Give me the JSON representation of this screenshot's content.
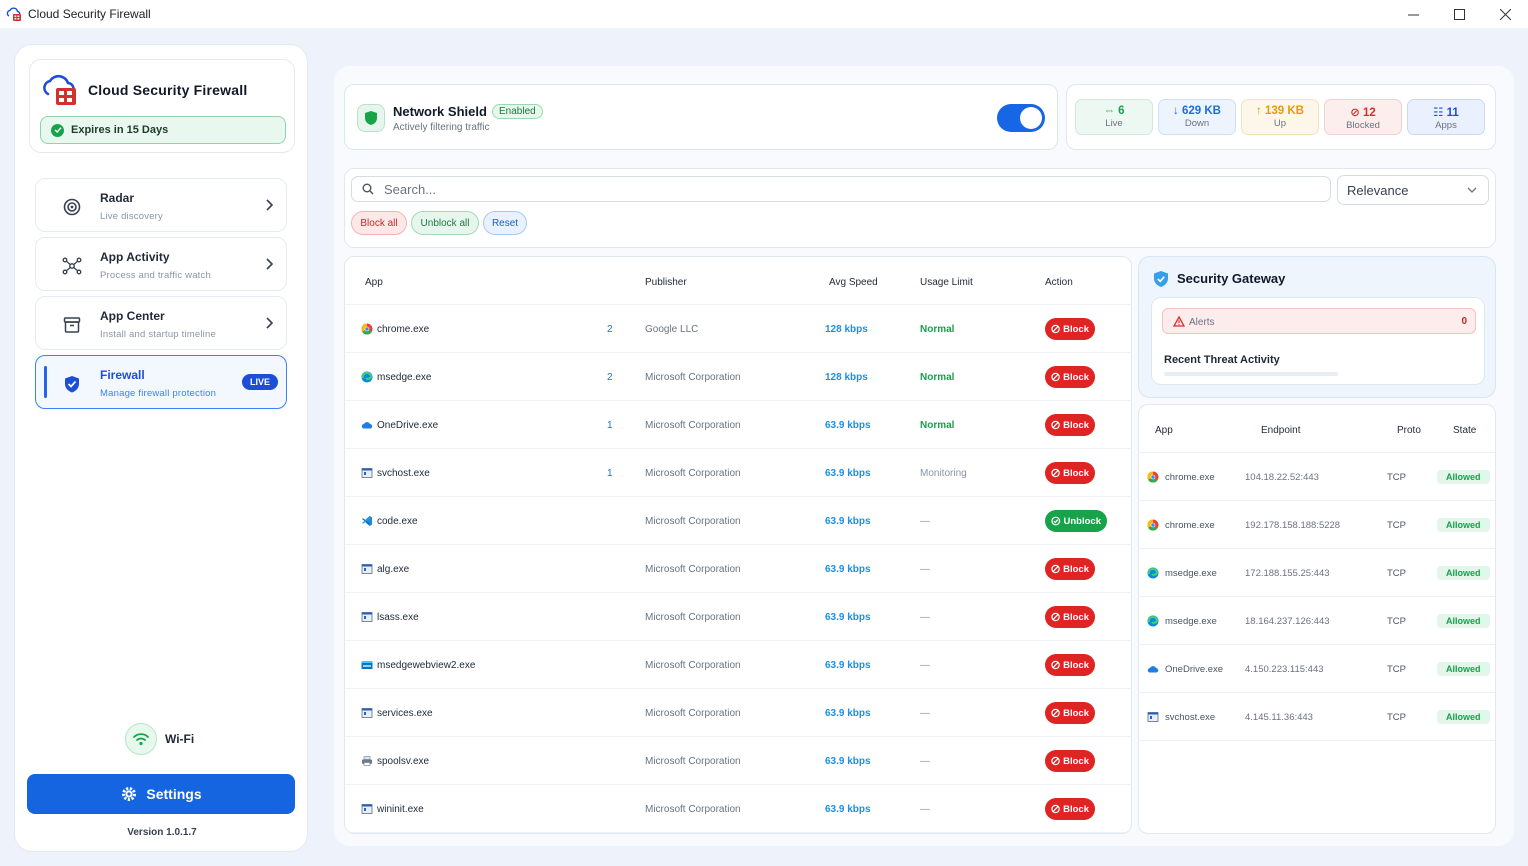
{
  "window": {
    "title": "Cloud Security Firewall",
    "minimize": "—",
    "maximize": "☐",
    "close": "✕"
  },
  "sidebar": {
    "brand": "Cloud Security Firewall",
    "expires": "Expires in 15 Days",
    "items": [
      {
        "label": "Radar",
        "sub": "Live discovery"
      },
      {
        "label": "App Activity",
        "sub": "Process and traffic watch"
      },
      {
        "label": "App Center",
        "sub": "Install and startup timeline"
      },
      {
        "label": "Firewall",
        "sub": "Manage firewall protection",
        "badge": "LIVE"
      }
    ],
    "wifi": "Wi-Fi",
    "settings": "Settings",
    "version": "Version 1.0.1.7"
  },
  "shield": {
    "title": "Network Shield",
    "badge": "Enabled",
    "sub": "Actively filtering traffic",
    "enabled": true
  },
  "stats": [
    {
      "value": "⇔ 6",
      "label": "Live",
      "color": "#16a34a",
      "bg": "#eef8f2",
      "border": "#cfe9da"
    },
    {
      "value": "↓ 629 KB",
      "label": "Down",
      "color": "#1d6fd8",
      "bg": "#edf4fd",
      "border": "#cfe0f5"
    },
    {
      "value": "↑ 139 KB",
      "label": "Up",
      "color": "#e59a0e",
      "bg": "#fdf7ea",
      "border": "#f3e2b8"
    },
    {
      "value": "⊘ 12",
      "label": "Blocked",
      "color": "#d32f2f",
      "bg": "#fdeeee",
      "border": "#f4cfcf"
    },
    {
      "value": "☷ 11",
      "label": "Apps",
      "color": "#1d4ed8",
      "bg": "#eaf0fd",
      "border": "#cbd8f5"
    }
  ],
  "search": {
    "placeholder": "Search...",
    "sort": "Relevance",
    "block_all": "Block all",
    "unblock_all": "Unblock all",
    "reset": "Reset"
  },
  "apps": {
    "headers": {
      "app": "App",
      "publisher": "Publisher",
      "speed": "Avg Speed",
      "usage": "Usage Limit",
      "action": "Action"
    },
    "rows": [
      {
        "name": "chrome.exe",
        "count": "2",
        "publisher": "Google LLC",
        "speed": "128 kbps",
        "usage": "Normal",
        "usage_type": "normal",
        "action": "Block",
        "icon": "chrome-icon"
      },
      {
        "name": "msedge.exe",
        "count": "2",
        "publisher": "Microsoft Corporation",
        "speed": "128 kbps",
        "usage": "Normal",
        "usage_type": "normal",
        "action": "Block",
        "icon": "edge-icon"
      },
      {
        "name": "OneDrive.exe",
        "count": "1",
        "publisher": "Microsoft Corporation",
        "speed": "63.9 kbps",
        "usage": "Normal",
        "usage_type": "normal",
        "action": "Block",
        "icon": "onedrive-icon"
      },
      {
        "name": "svchost.exe",
        "count": "1",
        "publisher": "Microsoft Corporation",
        "speed": "63.9 kbps",
        "usage": "Monitoring",
        "usage_type": "mon",
        "action": "Block",
        "icon": "window-icon"
      },
      {
        "name": "code.exe",
        "count": "",
        "publisher": "Microsoft Corporation",
        "speed": "63.9 kbps",
        "usage": "—",
        "usage_type": "none",
        "action": "Unblock",
        "icon": "vscode-icon"
      },
      {
        "name": "alg.exe",
        "count": "",
        "publisher": "Microsoft Corporation",
        "speed": "63.9 kbps",
        "usage": "—",
        "usage_type": "none",
        "action": "Block",
        "icon": "window-icon"
      },
      {
        "name": "lsass.exe",
        "count": "",
        "publisher": "Microsoft Corporation",
        "speed": "63.9 kbps",
        "usage": "—",
        "usage_type": "none",
        "action": "Block",
        "icon": "window-icon"
      },
      {
        "name": "msedgewebview2.exe",
        "count": "",
        "publisher": "Microsoft Corporation",
        "speed": "63.9 kbps",
        "usage": "—",
        "usage_type": "none",
        "action": "Block",
        "icon": "webview-icon"
      },
      {
        "name": "services.exe",
        "count": "",
        "publisher": "Microsoft Corporation",
        "speed": "63.9 kbps",
        "usage": "—",
        "usage_type": "none",
        "action": "Block",
        "icon": "window-icon"
      },
      {
        "name": "spoolsv.exe",
        "count": "",
        "publisher": "Microsoft Corporation",
        "speed": "63.9 kbps",
        "usage": "—",
        "usage_type": "none",
        "action": "Block",
        "icon": "printer-icon"
      },
      {
        "name": "wininit.exe",
        "count": "",
        "publisher": "Microsoft Corporation",
        "speed": "63.9 kbps",
        "usage": "—",
        "usage_type": "none",
        "action": "Block",
        "icon": "window-icon"
      }
    ]
  },
  "gateway": {
    "title": "Security Gateway",
    "alerts_label": "Alerts",
    "alerts_count": "0",
    "recent": "Recent Threat Activity"
  },
  "connections": {
    "headers": {
      "app": "App",
      "endpoint": "Endpoint",
      "proto": "Proto",
      "state": "State"
    },
    "rows": [
      {
        "app": "chrome.exe",
        "endpoint": "104.18.22.52:443",
        "proto": "TCP",
        "state": "Allowed",
        "icon": "chrome-icon"
      },
      {
        "app": "chrome.exe",
        "endpoint": "192.178.158.188:5228",
        "proto": "TCP",
        "state": "Allowed",
        "icon": "chrome-icon"
      },
      {
        "app": "msedge.exe",
        "endpoint": "172.188.155.25:443",
        "proto": "TCP",
        "state": "Allowed",
        "icon": "edge-icon"
      },
      {
        "app": "msedge.exe",
        "endpoint": "18.164.237.126:443",
        "proto": "TCP",
        "state": "Allowed",
        "icon": "edge-icon"
      },
      {
        "app": "OneDrive.exe",
        "endpoint": "4.150.223.115:443",
        "proto": "TCP",
        "state": "Allowed",
        "icon": "onedrive-icon"
      },
      {
        "app": "svchost.exe",
        "endpoint": "4.145.11.36:443",
        "proto": "TCP",
        "state": "Allowed",
        "icon": "window-icon"
      }
    ]
  }
}
